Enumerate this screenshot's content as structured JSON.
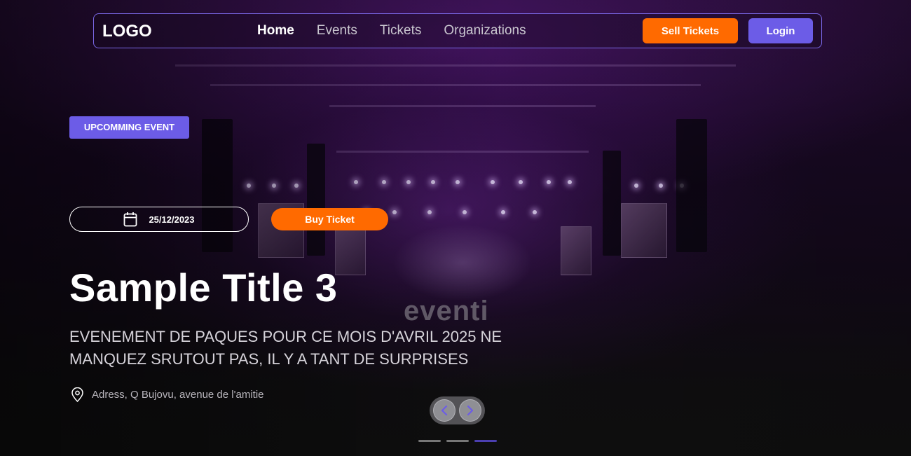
{
  "nav": {
    "logo": "LOGO",
    "links": [
      {
        "label": "Home",
        "active": true
      },
      {
        "label": "Events",
        "active": false
      },
      {
        "label": "Tickets",
        "active": false
      },
      {
        "label": "Organizations",
        "active": false
      }
    ],
    "sell_label": "Sell Tickets",
    "login_label": "Login"
  },
  "hero": {
    "badge": "UPCOMMING EVENT",
    "date": "25/12/2023",
    "buy_label": "Buy Ticket",
    "title": "Sample Title 3",
    "subtitle": "EVENEMENT DE PAQUES POUR CE MOIS D'AVRIL 2025 NE MANQUEZ SRUTOUT PAS, IL Y A TANT DE SURPRISES",
    "address": "Adress, Q Bujovu, avenue de l'amitie",
    "watermark": "eventi"
  },
  "carousel": {
    "slide_count": 3,
    "active_index": 2
  },
  "colors": {
    "accent_purple": "#6c5ce7",
    "accent_orange": "#ff6a00"
  },
  "icons": {
    "date": "calendar-icon",
    "address": "map-pin-icon",
    "prev": "chevron-left-icon",
    "next": "chevron-right-icon"
  }
}
